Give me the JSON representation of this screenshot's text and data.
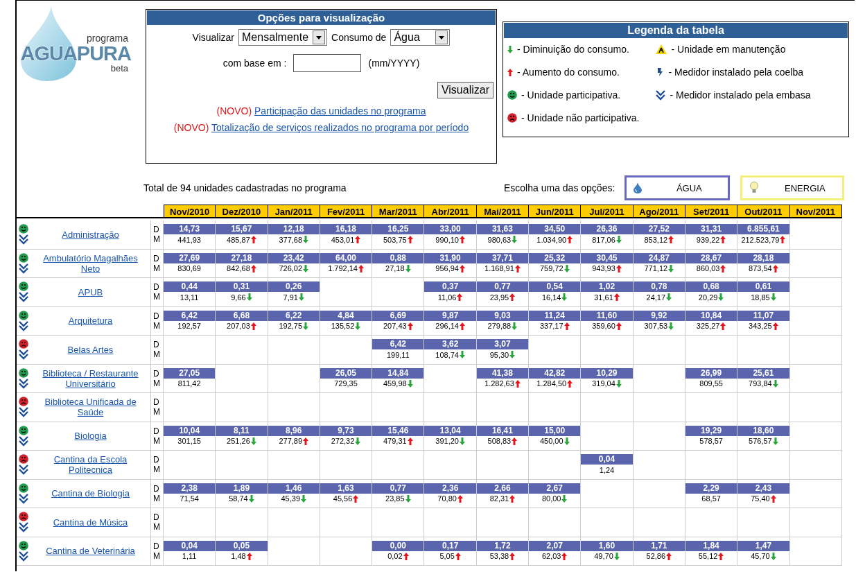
{
  "logo": {
    "small": "programa",
    "name": "AGUAPURA",
    "tag": "beta"
  },
  "options": {
    "title": "Opções para visualização",
    "view_label": "Visualizar",
    "view_value": "Mensalmente",
    "consumption_label": "Consumo de",
    "consumption_value": "Água",
    "base_label": "com base em :",
    "base_hint": "(mm/YYYY)",
    "button": "Visualizar",
    "links": [
      {
        "badge": "(NOVO)",
        "text": "Participação das unidades no programa"
      },
      {
        "badge": "(NOVO)",
        "text": "Totalização de serviços realizados no programa por período"
      }
    ]
  },
  "legend": {
    "title": "Legenda da tabela",
    "columns": [
      [
        {
          "kind": "down",
          "label": "- Diminuição do consumo."
        },
        {
          "kind": "up",
          "label": "- Aumento do consumo."
        },
        {
          "kind": "happy",
          "label": "- Unidade participativa."
        },
        {
          "kind": "sad",
          "label": "- Unidade não participativa."
        }
      ],
      [
        {
          "kind": "maintenance",
          "label": "- Unidade em manutenção"
        },
        {
          "kind": "coelba",
          "label": "- Medidor instalado pela coelba"
        },
        {
          "kind": "embasa",
          "label": "- Medidor instalado pela embasa"
        }
      ]
    ]
  },
  "summary": "Total de 94 unidades cadastradas no programa",
  "choices": {
    "label": "Escolha uma das opções:",
    "buttons": [
      {
        "kind": "water",
        "label": "ÁGUA"
      },
      {
        "kind": "energy",
        "label": "ENERGIA"
      }
    ]
  },
  "table": {
    "months": [
      "Nov/2010",
      "Dez/2010",
      "Jan/2011",
      "Fev/2011",
      "Mar/2011",
      "Abr/2011",
      "Mai/2011",
      "Jun/2011",
      "Jul/2011",
      "Ago/2011",
      "Set/2011",
      "Out/2011",
      "Nov/2011"
    ],
    "rows": [
      {
        "name": "Administração",
        "participative": true,
        "d_label": "D",
        "m_label": "M",
        "cells": [
          {
            "kind": "flat",
            "d": "14,73",
            "m": "441,93"
          },
          {
            "kind": "up",
            "d": "15,67",
            "m": "485,87"
          },
          {
            "kind": "down",
            "d": "12,18",
            "m": "377,68"
          },
          {
            "kind": "up",
            "d": "16,18",
            "m": "453,01"
          },
          {
            "kind": "up",
            "d": "16,25",
            "m": "503,75"
          },
          {
            "kind": "up",
            "d": "33,00",
            "m": "990,10"
          },
          {
            "kind": "down",
            "d": "31,63",
            "m": "980,63"
          },
          {
            "kind": "up",
            "d": "34,50",
            "m": "1.034,90"
          },
          {
            "kind": "down",
            "d": "26,36",
            "m": "817,06"
          },
          {
            "kind": "up",
            "d": "27,52",
            "m": "853,12"
          },
          {
            "kind": "up",
            "d": "31,31",
            "m": "939,22"
          },
          {
            "kind": "up",
            "d": "6.855,61",
            "m": "212.523,79"
          },
          {
            "kind": "blank"
          }
        ]
      },
      {
        "name": "Ambulatório Magalhães Neto",
        "participative": true,
        "d_label": "D",
        "m_label": "M",
        "cells": [
          {
            "kind": "flat",
            "d": "27,69",
            "m": "830,69"
          },
          {
            "kind": "up",
            "d": "27,18",
            "m": "842,68"
          },
          {
            "kind": "down",
            "d": "23,42",
            "m": "726,02"
          },
          {
            "kind": "up",
            "d": "64,00",
            "m": "1.792,14"
          },
          {
            "kind": "down",
            "d": "0,88",
            "m": "27,18"
          },
          {
            "kind": "up",
            "d": "31,90",
            "m": "956,94"
          },
          {
            "kind": "up",
            "d": "37,71",
            "m": "1.168,91"
          },
          {
            "kind": "down",
            "d": "25,32",
            "m": "759,72"
          },
          {
            "kind": "up",
            "d": "30,45",
            "m": "943,93"
          },
          {
            "kind": "down",
            "d": "24,87",
            "m": "771,12"
          },
          {
            "kind": "up",
            "d": "28,67",
            "m": "860,03"
          },
          {
            "kind": "up",
            "d": "28,18",
            "m": "873,54"
          },
          {
            "kind": "blank"
          }
        ]
      },
      {
        "name": "APUB",
        "participative": true,
        "d_label": "D",
        "m_label": "M",
        "cells": [
          {
            "kind": "flat",
            "d": "0,44",
            "m": "13,11"
          },
          {
            "kind": "down",
            "d": "0,31",
            "m": "9,66"
          },
          {
            "kind": "down",
            "d": "0,26",
            "m": "7,91"
          },
          {
            "kind": "blank"
          },
          {
            "kind": "blank"
          },
          {
            "kind": "up",
            "d": "0,37",
            "m": "11,06"
          },
          {
            "kind": "up",
            "d": "0,77",
            "m": "23,95"
          },
          {
            "kind": "down",
            "d": "0,54",
            "m": "16,14"
          },
          {
            "kind": "up",
            "d": "1,02",
            "m": "31,61"
          },
          {
            "kind": "down",
            "d": "0,78",
            "m": "24,17"
          },
          {
            "kind": "down",
            "d": "0,68",
            "m": "20,29"
          },
          {
            "kind": "down",
            "d": "0,61",
            "m": "18,85"
          },
          {
            "kind": "blank"
          }
        ]
      },
      {
        "name": "Arquitetura",
        "participative": true,
        "d_label": "D",
        "m_label": "M",
        "cells": [
          {
            "kind": "flat",
            "d": "6,42",
            "m": "192,57"
          },
          {
            "kind": "up",
            "d": "6,68",
            "m": "207,03"
          },
          {
            "kind": "down",
            "d": "6,22",
            "m": "192,75"
          },
          {
            "kind": "down",
            "d": "4,84",
            "m": "135,52"
          },
          {
            "kind": "up",
            "d": "6,69",
            "m": "207,43"
          },
          {
            "kind": "up",
            "d": "9,87",
            "m": "296,14"
          },
          {
            "kind": "down",
            "d": "9,03",
            "m": "279,88"
          },
          {
            "kind": "up",
            "d": "11,24",
            "m": "337,17"
          },
          {
            "kind": "up",
            "d": "11,60",
            "m": "359,60"
          },
          {
            "kind": "down",
            "d": "9,92",
            "m": "307,53"
          },
          {
            "kind": "up",
            "d": "10,84",
            "m": "325,27"
          },
          {
            "kind": "up",
            "d": "11,07",
            "m": "343,25"
          },
          {
            "kind": "blank"
          }
        ]
      },
      {
        "name": "Belas Artes",
        "participative": false,
        "d_label": "D",
        "m_label": "M",
        "cells": [
          {
            "kind": "blank"
          },
          {
            "kind": "blank"
          },
          {
            "kind": "blank"
          },
          {
            "kind": "blank"
          },
          {
            "kind": "flat",
            "d": "6,42",
            "m": "199,11"
          },
          {
            "kind": "down",
            "d": "3,62",
            "m": "108,74"
          },
          {
            "kind": "down",
            "d": "3,07",
            "m": "95,30"
          },
          {
            "kind": "blank"
          },
          {
            "kind": "blank"
          },
          {
            "kind": "blank"
          },
          {
            "kind": "blank"
          },
          {
            "kind": "blank"
          },
          {
            "kind": "blank"
          }
        ]
      },
      {
        "name": "Biblioteca / Restaurante Universitário",
        "participative": true,
        "d_label": "D",
        "m_label": "M",
        "cells": [
          {
            "kind": "flat",
            "d": "27,05",
            "m": "811,42"
          },
          {
            "kind": "blank"
          },
          {
            "kind": "blank"
          },
          {
            "kind": "flat",
            "d": "26,05",
            "m": "729,35"
          },
          {
            "kind": "down",
            "d": "14,84",
            "m": "459,98"
          },
          {
            "kind": "blank"
          },
          {
            "kind": "up",
            "d": "41,38",
            "m": "1.282,63"
          },
          {
            "kind": "up",
            "d": "42,82",
            "m": "1.284,50"
          },
          {
            "kind": "down",
            "d": "10,29",
            "m": "319,04"
          },
          {
            "kind": "blank"
          },
          {
            "kind": "flat",
            "d": "26,99",
            "m": "809,55"
          },
          {
            "kind": "down",
            "d": "25,61",
            "m": "793,84"
          },
          {
            "kind": "blank"
          }
        ]
      },
      {
        "name": "Biblioteca Unificada de Saúde",
        "participative": false,
        "d_label": "D",
        "m_label": "M",
        "cells": [
          {
            "kind": "blank"
          },
          {
            "kind": "blank"
          },
          {
            "kind": "blank"
          },
          {
            "kind": "blank"
          },
          {
            "kind": "blank"
          },
          {
            "kind": "blank"
          },
          {
            "kind": "blank"
          },
          {
            "kind": "blank"
          },
          {
            "kind": "blank"
          },
          {
            "kind": "blank"
          },
          {
            "kind": "blank"
          },
          {
            "kind": "blank"
          },
          {
            "kind": "blank"
          }
        ]
      },
      {
        "name": "Biologia",
        "participative": true,
        "d_label": "D",
        "m_label": "M",
        "cells": [
          {
            "kind": "flat",
            "d": "10,04",
            "m": "301,15"
          },
          {
            "kind": "down",
            "d": "8,11",
            "m": "251,26"
          },
          {
            "kind": "up",
            "d": "8,96",
            "m": "277,89"
          },
          {
            "kind": "down",
            "d": "9,73",
            "m": "272,32"
          },
          {
            "kind": "up",
            "d": "15,46",
            "m": "479,31"
          },
          {
            "kind": "down",
            "d": "13,04",
            "m": "391,20"
          },
          {
            "kind": "up",
            "d": "16,41",
            "m": "508,83"
          },
          {
            "kind": "down",
            "d": "15,00",
            "m": "450,00"
          },
          {
            "kind": "blank"
          },
          {
            "kind": "blank"
          },
          {
            "kind": "flat",
            "d": "19,29",
            "m": "578,57"
          },
          {
            "kind": "down",
            "d": "18,60",
            "m": "576,57"
          },
          {
            "kind": "blank"
          }
        ]
      },
      {
        "name": "Cantina da Escola Politecnica",
        "participative": false,
        "d_label": "D",
        "m_label": "M",
        "cells": [
          {
            "kind": "blank"
          },
          {
            "kind": "blank"
          },
          {
            "kind": "blank"
          },
          {
            "kind": "blank"
          },
          {
            "kind": "blank"
          },
          {
            "kind": "blank"
          },
          {
            "kind": "blank"
          },
          {
            "kind": "blank"
          },
          {
            "kind": "flat",
            "d": "0,04",
            "m": "1,24"
          },
          {
            "kind": "blank"
          },
          {
            "kind": "blank"
          },
          {
            "kind": "blank"
          },
          {
            "kind": "blank"
          }
        ]
      },
      {
        "name": "Cantina de Biologia",
        "participative": true,
        "d_label": "D",
        "m_label": "M",
        "cells": [
          {
            "kind": "flat",
            "d": "2,38",
            "m": "71,54"
          },
          {
            "kind": "down",
            "d": "1,89",
            "m": "58,74"
          },
          {
            "kind": "down",
            "d": "1,46",
            "m": "45,39"
          },
          {
            "kind": "up",
            "d": "1,63",
            "m": "45,56"
          },
          {
            "kind": "down",
            "d": "0,77",
            "m": "23,85"
          },
          {
            "kind": "up",
            "d": "2,36",
            "m": "70,80"
          },
          {
            "kind": "up",
            "d": "2,66",
            "m": "82,31"
          },
          {
            "kind": "down",
            "d": "2,67",
            "m": "80,00"
          },
          {
            "kind": "blank"
          },
          {
            "kind": "blank"
          },
          {
            "kind": "flat",
            "d": "2,29",
            "m": "68,57"
          },
          {
            "kind": "up",
            "d": "2,43",
            "m": "75,40"
          },
          {
            "kind": "blank"
          }
        ]
      },
      {
        "name": "Cantina de Música",
        "participative": false,
        "d_label": "D",
        "m_label": "M",
        "cells": [
          {
            "kind": "blank"
          },
          {
            "kind": "blank"
          },
          {
            "kind": "blank"
          },
          {
            "kind": "blank"
          },
          {
            "kind": "blank"
          },
          {
            "kind": "blank"
          },
          {
            "kind": "blank"
          },
          {
            "kind": "blank"
          },
          {
            "kind": "blank"
          },
          {
            "kind": "blank"
          },
          {
            "kind": "blank"
          },
          {
            "kind": "blank"
          },
          {
            "kind": "blank"
          }
        ]
      },
      {
        "name": "Cantina de Veterinária",
        "participative": true,
        "d_label": "D",
        "m_label": "M",
        "cells": [
          {
            "kind": "flat",
            "d": "0,04",
            "m": "1,11"
          },
          {
            "kind": "up",
            "d": "0,05",
            "m": "1,48"
          },
          {
            "kind": "blank"
          },
          {
            "kind": "blank"
          },
          {
            "kind": "up",
            "d": "0,00",
            "m": "0,02"
          },
          {
            "kind": "up",
            "d": "0,17",
            "m": "5,05"
          },
          {
            "kind": "up",
            "d": "1,72",
            "m": "53,38"
          },
          {
            "kind": "up",
            "d": "2,07",
            "m": "62,03"
          },
          {
            "kind": "down",
            "d": "1,60",
            "m": "49,70"
          },
          {
            "kind": "up",
            "d": "1,71",
            "m": "52,86"
          },
          {
            "kind": "up",
            "d": "1,84",
            "m": "55,12"
          },
          {
            "kind": "down",
            "d": "1,47",
            "m": "45,70"
          },
          {
            "kind": "blank"
          }
        ]
      }
    ]
  }
}
